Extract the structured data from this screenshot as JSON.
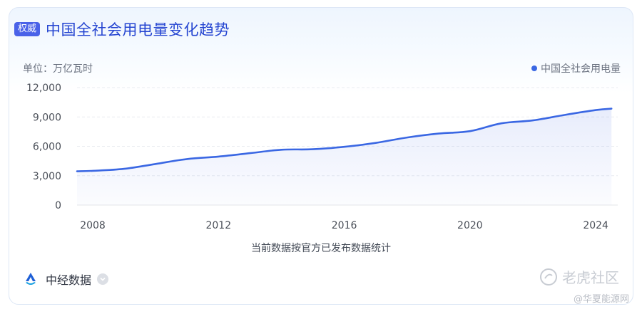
{
  "header": {
    "badge": "权威",
    "title": "中国全社会用电量变化趋势"
  },
  "unit_label": "单位：万亿瓦时",
  "legend_label": "中国全社会用电量",
  "footnote": "当前数据按官方已发布数据统计",
  "brand": {
    "name": "中经数据"
  },
  "watermark": {
    "primary": "老虎社区",
    "secondary": "@华夏能源网"
  },
  "colors": {
    "line": "#3a67e3",
    "accent": "#4a62e8",
    "title": "#2545d1"
  },
  "chart_data": {
    "type": "area",
    "title": "中国全社会用电量变化趋势",
    "ylabel": "单位：万亿瓦时",
    "xlabel": "",
    "ylim": [
      0,
      12000
    ],
    "yticks": [
      0,
      3000,
      6000,
      9000,
      12000
    ],
    "ytick_labels": [
      "0",
      "3,000",
      "6,000",
      "9,000",
      "12,000"
    ],
    "xlim": [
      2007.5,
      2024.7
    ],
    "xticks": [
      2008,
      2012,
      2016,
      2020,
      2024
    ],
    "grid": true,
    "legend": "top-right",
    "series": [
      {
        "name": "中国全社会用电量",
        "x": [
          2007.5,
          2008,
          2009,
          2010,
          2011,
          2012,
          2013,
          2014,
          2015,
          2016,
          2017,
          2018,
          2019,
          2020,
          2021,
          2022,
          2023,
          2024,
          2024.5
        ],
        "values": [
          3450,
          3500,
          3700,
          4200,
          4700,
          4950,
          5300,
          5650,
          5700,
          5950,
          6350,
          6900,
          7300,
          7550,
          8350,
          8650,
          9200,
          9700,
          9850
        ]
      }
    ]
  }
}
